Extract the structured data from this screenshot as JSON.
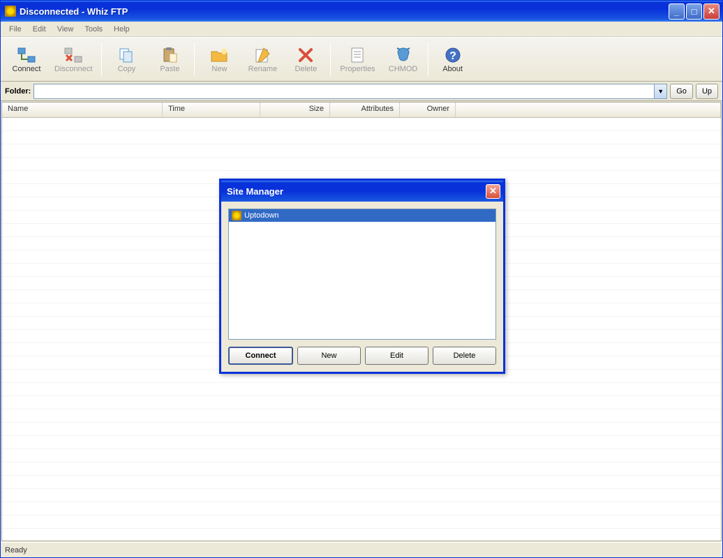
{
  "window": {
    "title": "Disconnected - Whiz FTP"
  },
  "menu": {
    "file": "File",
    "edit": "Edit",
    "view": "View",
    "tools": "Tools",
    "help": "Help"
  },
  "toolbar": {
    "connect": "Connect",
    "disconnect": "Disconnect",
    "copy": "Copy",
    "paste": "Paste",
    "new": "New",
    "rename": "Rename",
    "delete": "Delete",
    "properties": "Properties",
    "chmod": "CHMOD",
    "about": "About"
  },
  "folderbar": {
    "label": "Folder:",
    "value": "",
    "go": "Go",
    "up": "Up"
  },
  "columns": {
    "name": "Name",
    "time": "Time",
    "size": "Size",
    "attributes": "Attributes",
    "owner": "Owner"
  },
  "status": {
    "text": "Ready"
  },
  "dialog": {
    "title": "Site Manager",
    "sites": [
      {
        "name": "Uptodown"
      }
    ],
    "buttons": {
      "connect": "Connect",
      "new": "New",
      "edit": "Edit",
      "delete": "Delete"
    }
  }
}
